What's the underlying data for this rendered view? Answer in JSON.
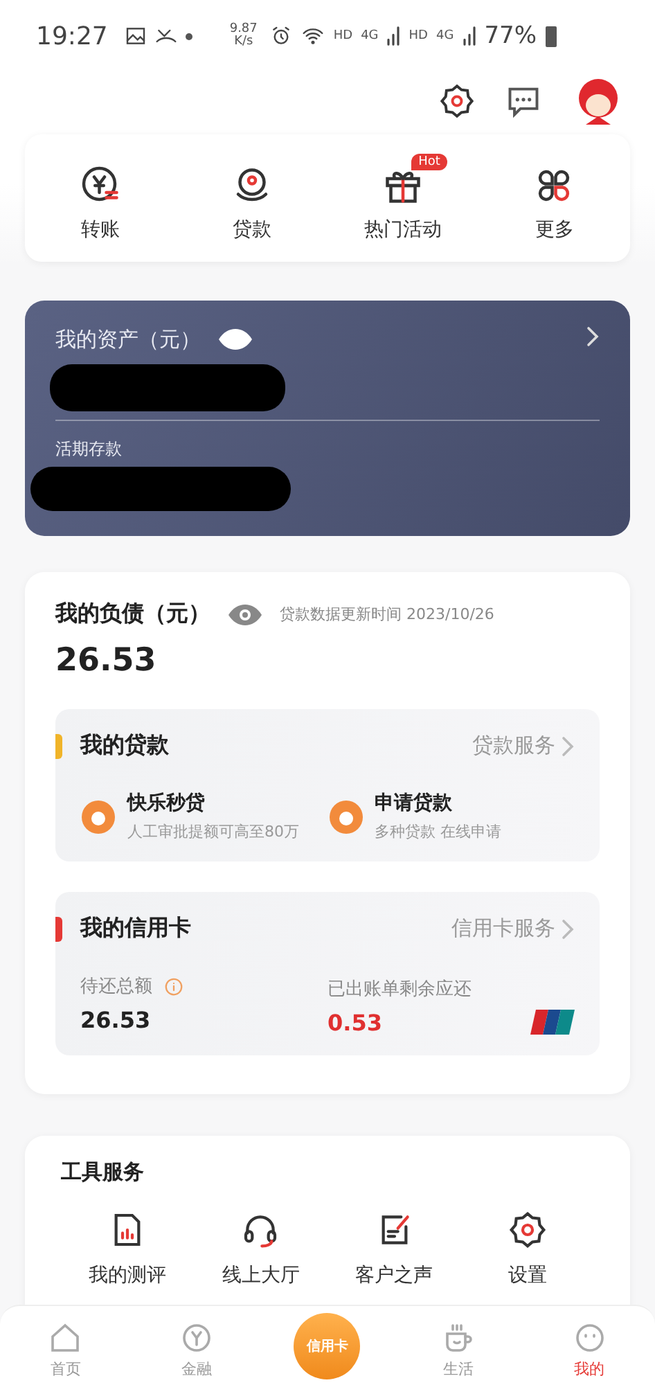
{
  "status_bar": {
    "time": "19:27",
    "speed": "9.87 K/s",
    "hd_1": "HD",
    "net_1": "4G",
    "hd_2": "HD",
    "net_2": "4G",
    "battery": "77%"
  },
  "quick_actions": [
    {
      "label": "转账"
    },
    {
      "label": "贷款"
    },
    {
      "label": "热门活动",
      "badge": "Hot"
    },
    {
      "label": "更多"
    }
  ],
  "assets": {
    "title": "我的资产（元）",
    "deposit_label": "活期存款"
  },
  "debt": {
    "title": "我的负债（元）",
    "update_note": "贷款数据更新时间 2023/10/26",
    "amount": "26.53",
    "loans": {
      "title": "我的贷款",
      "link": "贷款服务",
      "color": "#f0b429",
      "items": [
        {
          "title": "快乐秒贷",
          "subtitle": "人工审批提额可高至80万"
        },
        {
          "title": "申请贷款",
          "subtitle": "多种贷款 在线申请"
        }
      ]
    },
    "credit": {
      "title": "我的信用卡",
      "link": "信用卡服务",
      "color": "#e53935",
      "total_label": "待还总额",
      "total": "26.53",
      "billed_label": "已出账单剩余应还",
      "billed": "0.53"
    }
  },
  "tools": {
    "title": "工具服务",
    "items": [
      {
        "label": "我的测评"
      },
      {
        "label": "线上大厅"
      },
      {
        "label": "客户之声"
      },
      {
        "label": "设置"
      }
    ]
  },
  "bottom_nav": [
    {
      "label": "首页",
      "kind": "tab",
      "selected": false
    },
    {
      "label": "金融",
      "kind": "tab",
      "selected": false
    },
    {
      "label": "信用卡",
      "kind": "center",
      "selected": false
    },
    {
      "label": "生活",
      "kind": "tab",
      "selected": false
    },
    {
      "label": "我的",
      "kind": "tab",
      "selected": true
    }
  ]
}
